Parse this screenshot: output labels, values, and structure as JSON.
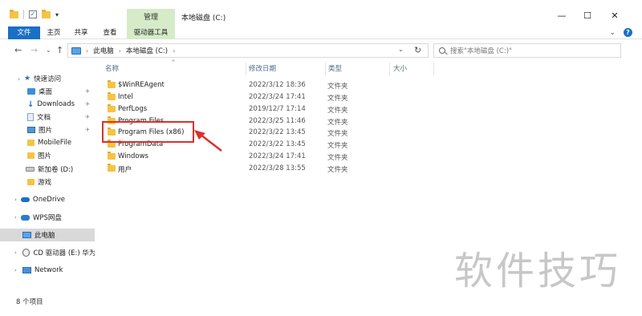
{
  "window": {
    "title": "本地磁盘 (C:)",
    "context_tab": "管理",
    "minimize": "—",
    "maximize": "☐",
    "close": "✕"
  },
  "ribbon": {
    "tabs": [
      "文件",
      "主页",
      "共享",
      "查看",
      "驱动器工具"
    ],
    "expand": "⌄",
    "help": "?"
  },
  "nav": {
    "back": "←",
    "forward": "→",
    "recent": "⌄",
    "up": "↑",
    "breadcrumb": [
      "此电脑",
      "本地磁盘 (C:)"
    ],
    "refresh": "↻",
    "search_placeholder": "搜索\"本地磁盘 (C:)\""
  },
  "sidebar": {
    "items": [
      {
        "label": "快速访问",
        "icon": "star-icon"
      },
      {
        "label": "桌面",
        "icon": "desktop-icon",
        "pinned": true
      },
      {
        "label": "Downloads",
        "icon": "download-icon",
        "pinned": true
      },
      {
        "label": "文档",
        "icon": "document-icon",
        "pinned": true
      },
      {
        "label": "图片",
        "icon": "pictures-icon",
        "pinned": true
      },
      {
        "label": "MobileFile",
        "icon": "folder-icon"
      },
      {
        "label": "图片",
        "icon": "folder-icon"
      },
      {
        "label": "新加卷 (D:)",
        "icon": "drive-icon"
      },
      {
        "label": "游戏",
        "icon": "folder-icon"
      },
      {
        "label": "OneDrive",
        "icon": "cloud-icon"
      },
      {
        "label": "WPS网盘",
        "icon": "wps-cloud-icon"
      },
      {
        "label": "此电脑",
        "icon": "computer-icon",
        "selected": true
      },
      {
        "label": "CD 驱动器 (E:) 华为手",
        "icon": "cd-drive-icon"
      },
      {
        "label": "Network",
        "icon": "network-icon"
      }
    ]
  },
  "columns": {
    "name": "名称",
    "modified": "修改日期",
    "type": "类型",
    "size": "大小"
  },
  "files": [
    {
      "name": "$WinREAgent",
      "modified": "2022/3/12 18:36",
      "type": "文件夹"
    },
    {
      "name": "Intel",
      "modified": "2022/3/24 17:41",
      "type": "文件夹"
    },
    {
      "name": "PerfLogs",
      "modified": "2019/12/7 17:14",
      "type": "文件夹"
    },
    {
      "name": "Program Files",
      "modified": "2022/3/25 11:46",
      "type": "文件夹"
    },
    {
      "name": "Program Files (x86)",
      "modified": "2022/3/22 13:45",
      "type": "文件夹"
    },
    {
      "name": "ProgramData",
      "modified": "2022/3/22 13:45",
      "type": "文件夹"
    },
    {
      "name": "Windows",
      "modified": "2022/3/24 17:41",
      "type": "文件夹"
    },
    {
      "name": "用户",
      "modified": "2022/3/28 13:55",
      "type": "文件夹"
    }
  ],
  "status": {
    "count": "8 个项目"
  },
  "watermark": "软件技巧",
  "colors": {
    "accent": "#1a6fc7",
    "context_tab": "#d6ebc8",
    "highlight": "#d9322c",
    "folder": "#f4c442"
  }
}
